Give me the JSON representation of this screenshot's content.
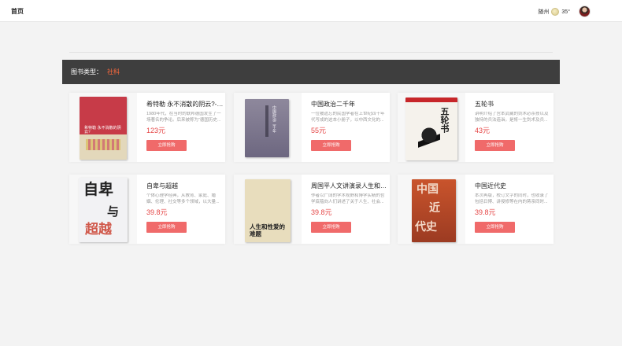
{
  "header": {
    "home_label": "首页",
    "weather": {
      "city": "随州",
      "temp": "35°",
      "icon": "weather-sun-icon"
    },
    "avatar": "user-avatar"
  },
  "filter": {
    "label": "图书类型：",
    "value": "社科"
  },
  "books": [
    {
      "title": "希特勒 永不消散的阴云?-德...",
      "desc": "1980年代，在当时的联邦德国发生了一场著名的争论。后来被称为“德国历史...",
      "price": "123元",
      "buy_label": "立即抢购"
    },
    {
      "title": "中国政治二千年",
      "desc": "一位被遗忘的民国学者在上世纪四十年代写成的这本小册子，以中西文化的...",
      "price": "55元",
      "buy_label": "立即抢购"
    },
    {
      "title": "五轮书",
      "desc": "讲明介绍了宫本武藏的剑术必杀技以及独特的兵法造诣。是将一生剑术及兵...",
      "price": "43元",
      "buy_label": "立即抢购"
    },
    {
      "title": "自卑与超越",
      "desc": "个体心理学经典，从教育、家庭、婚姻、伦理、社交等多个领域，以大量...",
      "price": "39.8元",
      "buy_label": "立即抢购"
    },
    {
      "title": "周国平人文讲演录人生和性...",
      "desc": "作者以广阔的学术视野和博学实精的哲学底蕴向人们讲述了关于人生、社会...",
      "price": "39.8元",
      "buy_label": "立即抢购"
    },
    {
      "title": "中国近代史",
      "desc": "本次再版，校订文字的同时，也收录了包括日博、讲授修等在内的蒋亲同时...",
      "price": "39.8元",
      "buy_label": "立即抢购"
    }
  ],
  "covers": {
    "c1_title": "希特勒 永不消散的阴云?",
    "c2_title": "中国政治二千年",
    "c3_title": "五轮书",
    "c4_title_a": "自卑",
    "c4_title_b": "与",
    "c4_title_c": "超越",
    "c5_title": "人生和性爱的难题",
    "c6_title_a": "中国",
    "c6_title_b": "近",
    "c6_title_c": "代史"
  }
}
